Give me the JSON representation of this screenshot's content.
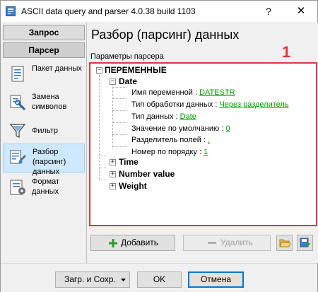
{
  "window": {
    "title": "ASCII data query and parser 4.0.38 build 1103",
    "help_glyph": "?",
    "close_glyph": "✕"
  },
  "sidebar": {
    "tabs": [
      {
        "label": "Запрос"
      },
      {
        "label": "Парсер"
      }
    ],
    "items": [
      {
        "label": "Пакет данных",
        "icon": "package-icon"
      },
      {
        "label": "Замена символов",
        "icon": "replace-icon"
      },
      {
        "label": "Фильтр",
        "icon": "filter-icon"
      },
      {
        "label": "Разбор (парсинг) данных",
        "icon": "parse-icon",
        "active": true
      },
      {
        "label": "Формат данных",
        "icon": "format-icon"
      }
    ]
  },
  "main": {
    "title": "Разбор (парсинг) данных",
    "group_label": "Параметры парсера",
    "annotation_number": "1",
    "tree": {
      "root": "ПЕРЕМЕННЫЕ",
      "date": {
        "name": "Date",
        "props": [
          {
            "label": "Имя переменной : ",
            "value": "DATESTR"
          },
          {
            "label": "Тип обработки данных : ",
            "value": "Через разделитель"
          },
          {
            "label": "Тип данных : ",
            "value": "Date"
          },
          {
            "label": "Значение по умолчанию : ",
            "value": "0"
          },
          {
            "label": "Разделитель полей : ",
            "value": ","
          },
          {
            "label": "Номер по порядку : ",
            "value": "1"
          }
        ]
      },
      "others": [
        "Time",
        "Number value",
        "Weight"
      ]
    },
    "buttons": {
      "add": "Добавить",
      "delete": "Удалить"
    }
  },
  "footer": {
    "load_save": "Загр. и Сохр.",
    "ok": "OK",
    "cancel": "Отмена"
  },
  "colors": {
    "highlight_border": "#e0353b",
    "link": "#00a000",
    "active_item": "#cde8ff"
  }
}
